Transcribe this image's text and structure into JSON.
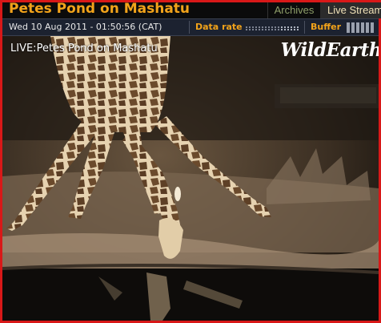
{
  "header": {
    "title": "Petes Pond on Mashatu",
    "tabs": [
      {
        "label": "Archives",
        "active": false
      },
      {
        "label": "Live Stream",
        "active": true
      }
    ]
  },
  "infobar": {
    "datetime": "Wed 10 Aug 2011 - 01:50:56 (CAT)",
    "data_rate_label": "Data rate",
    "buffer_label": "Buffer"
  },
  "video": {
    "live_label": "LIVE:Petes Pond on Mashatu",
    "watermark": "WildEarth"
  },
  "colors": {
    "frame_border": "#d81818",
    "title_accent": "#f2a31a",
    "infobar_bg": "#1c2230"
  }
}
